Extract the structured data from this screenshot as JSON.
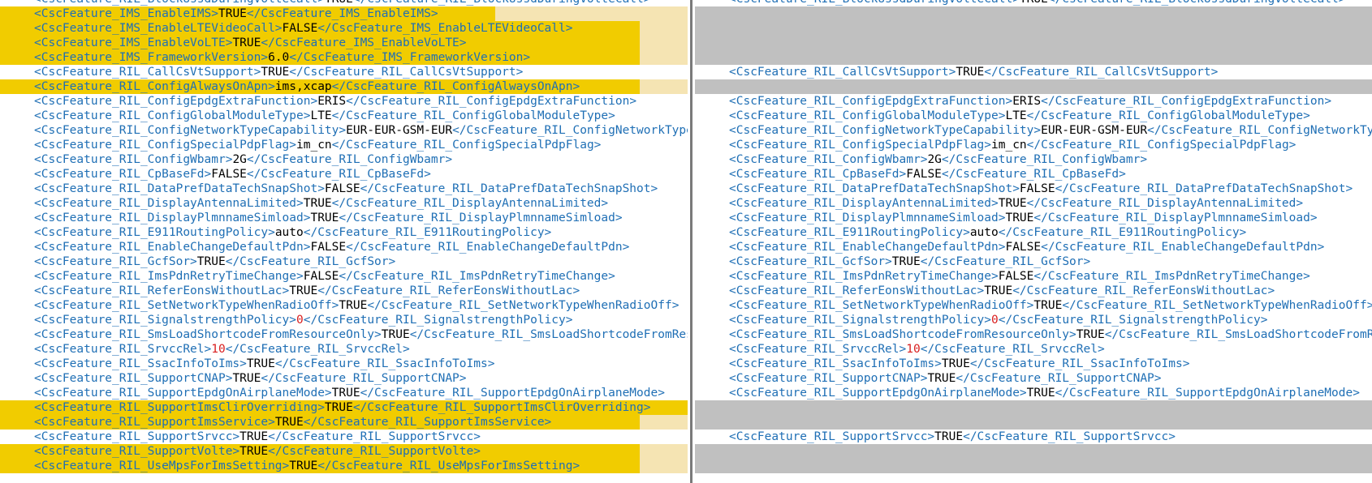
{
  "colors": {
    "tag": "#1f6fb5",
    "value": "#000000",
    "number": "#d92020",
    "changed_bg": "#f5e4b3",
    "changed_highlight": "#f1cc00",
    "gap": "#c0c0c0"
  },
  "left": [
    {
      "open": "<CscFeature_RIL_BlockUssdDuringVolteCall>",
      "value": "TRUE",
      "close": "</CscFeature_RIL_BlockUssdDuringVolteCall>",
      "state": "normal"
    },
    {
      "open": "<CscFeature_IMS_EnableIMS>",
      "value": "TRUE",
      "close": "</CscFeature_IMS_EnableIMS>",
      "state": "changed",
      "hl": 0.72
    },
    {
      "open": "<CscFeature_IMS_EnableLTEVideoCall>",
      "value": "FALSE",
      "close": "</CscFeature_IMS_EnableLTEVideoCall>",
      "state": "changed",
      "hl": 0.93
    },
    {
      "open": "<CscFeature_IMS_EnableVoLTE>",
      "value": "TRUE",
      "close": "</CscFeature_IMS_EnableVoLTE>",
      "state": "changed",
      "hl": 0.93
    },
    {
      "open": "<CscFeature_IMS_FrameworkVersion>",
      "value": "6.0",
      "close": "</CscFeature_IMS_FrameworkVersion>",
      "state": "changed",
      "hl": 0.93
    },
    {
      "open": "<CscFeature_RIL_CallCsVtSupport>",
      "value": "TRUE",
      "close": "</CscFeature_RIL_CallCsVtSupport>",
      "state": "normal"
    },
    {
      "open": "<CscFeature_RIL_ConfigAlwaysOnApn>",
      "value": "ims,xcap",
      "close": "</CscFeature_RIL_ConfigAlwaysOnApn>",
      "state": "changed",
      "hl": 0.93
    },
    {
      "open": "<CscFeature_RIL_ConfigEpdgExtraFunction>",
      "value": "ERIS",
      "close": "</CscFeature_RIL_ConfigEpdgExtraFunction>",
      "state": "normal"
    },
    {
      "open": "<CscFeature_RIL_ConfigGlobalModuleType>",
      "value": "LTE",
      "close": "</CscFeature_RIL_ConfigGlobalModuleType>",
      "state": "normal"
    },
    {
      "open": "<CscFeature_RIL_ConfigNetworkTypeCapability>",
      "value": "EUR-EUR-GSM-EUR",
      "close": "</CscFeature_RIL_ConfigNetworkTypeCapability>",
      "state": "normal"
    },
    {
      "open": "<CscFeature_RIL_ConfigSpecialPdpFlag>",
      "value": "im_cn",
      "close": "</CscFeature_RIL_ConfigSpecialPdpFlag>",
      "state": "normal"
    },
    {
      "open": "<CscFeature_RIL_ConfigWbamr>",
      "value": "2G",
      "close": "</CscFeature_RIL_ConfigWbamr>",
      "state": "normal"
    },
    {
      "open": "<CscFeature_RIL_CpBaseFd>",
      "value": "FALSE",
      "close": "</CscFeature_RIL_CpBaseFd>",
      "state": "normal"
    },
    {
      "open": "<CscFeature_RIL_DataPrefDataTechSnapShot>",
      "value": "FALSE",
      "close": "</CscFeature_RIL_DataPrefDataTechSnapShot>",
      "state": "normal"
    },
    {
      "open": "<CscFeature_RIL_DisplayAntennaLimited>",
      "value": "TRUE",
      "close": "</CscFeature_RIL_DisplayAntennaLimited>",
      "state": "normal"
    },
    {
      "open": "<CscFeature_RIL_DisplayPlmnnameSimload>",
      "value": "TRUE",
      "close": "</CscFeature_RIL_DisplayPlmnnameSimload>",
      "state": "normal"
    },
    {
      "open": "<CscFeature_RIL_E911RoutingPolicy>",
      "value": "auto",
      "close": "</CscFeature_RIL_E911RoutingPolicy>",
      "state": "normal"
    },
    {
      "open": "<CscFeature_RIL_EnableChangeDefaultPdn>",
      "value": "FALSE",
      "close": "</CscFeature_RIL_EnableChangeDefaultPdn>",
      "state": "normal"
    },
    {
      "open": "<CscFeature_RIL_GcfSor>",
      "value": "TRUE",
      "close": "</CscFeature_RIL_GcfSor>",
      "state": "normal"
    },
    {
      "open": "<CscFeature_RIL_ImsPdnRetryTimeChange>",
      "value": "FALSE",
      "close": "</CscFeature_RIL_ImsPdnRetryTimeChange>",
      "state": "normal"
    },
    {
      "open": "<CscFeature_RIL_ReferEonsWithoutLac>",
      "value": "TRUE",
      "close": "</CscFeature_RIL_ReferEonsWithoutLac>",
      "state": "normal"
    },
    {
      "open": "<CscFeature_RIL_SetNetworkTypeWhenRadioOff>",
      "value": "TRUE",
      "close": "</CscFeature_RIL_SetNetworkTypeWhenRadioOff>",
      "state": "normal"
    },
    {
      "open": "<CscFeature_RIL_SignalstrengthPolicy>",
      "value": "0",
      "close": "</CscFeature_RIL_SignalstrengthPolicy>",
      "state": "normal",
      "numeric": true
    },
    {
      "open": "<CscFeature_RIL_SmsLoadShortcodeFromResourceOnly>",
      "value": "TRUE",
      "close": "</CscFeature_RIL_SmsLoadShortcodeFromResourceOnly>",
      "state": "normal"
    },
    {
      "open": "<CscFeature_RIL_SrvccRel>",
      "value": "10",
      "close": "</CscFeature_RIL_SrvccRel>",
      "state": "normal",
      "numeric": true
    },
    {
      "open": "<CscFeature_RIL_SsacInfoToIms>",
      "value": "TRUE",
      "close": "</CscFeature_RIL_SsacInfoToIms>",
      "state": "normal"
    },
    {
      "open": "<CscFeature_RIL_SupportCNAP>",
      "value": "TRUE",
      "close": "</CscFeature_RIL_SupportCNAP>",
      "state": "normal"
    },
    {
      "open": "<CscFeature_RIL_SupportEpdgOnAirplaneMode>",
      "value": "TRUE",
      "close": "</CscFeature_RIL_SupportEpdgOnAirplaneMode>",
      "state": "normal"
    },
    {
      "open": "<CscFeature_RIL_SupportImsClirOverriding>",
      "value": "TRUE",
      "close": "</CscFeature_RIL_SupportImsClirOverriding>",
      "state": "changed",
      "hl": 1.0
    },
    {
      "open": "<CscFeature_RIL_SupportImsService>",
      "value": "TRUE",
      "close": "</CscFeature_RIL_SupportImsService>",
      "state": "changed",
      "hl": 0.93
    },
    {
      "open": "<CscFeature_RIL_SupportSrvcc>",
      "value": "TRUE",
      "close": "</CscFeature_RIL_SupportSrvcc>",
      "state": "normal"
    },
    {
      "open": "<CscFeature_RIL_SupportVolte>",
      "value": "TRUE",
      "close": "</CscFeature_RIL_SupportVolte>",
      "state": "changed",
      "hl": 0.93
    },
    {
      "open": "<CscFeature_RIL_UseMpsForImsSetting>",
      "value": "TRUE",
      "close": "</CscFeature_RIL_UseMpsForImsSetting>",
      "state": "changed",
      "hl": 0.93
    }
  ],
  "right": [
    {
      "open": "<CscFeature_RIL_BlockUssdDuringVolteCall>",
      "value": "TRUE",
      "close": "</CscFeature_RIL_BlockUssdDuringVolteCall>",
      "state": "normal"
    },
    {
      "state": "gap"
    },
    {
      "state": "gap"
    },
    {
      "state": "gap"
    },
    {
      "state": "gap"
    },
    {
      "open": "<CscFeature_RIL_CallCsVtSupport>",
      "value": "TRUE",
      "close": "</CscFeature_RIL_CallCsVtSupport>",
      "state": "normal"
    },
    {
      "state": "gap"
    },
    {
      "open": "<CscFeature_RIL_ConfigEpdgExtraFunction>",
      "value": "ERIS",
      "close": "</CscFeature_RIL_ConfigEpdgExtraFunction>",
      "state": "normal"
    },
    {
      "open": "<CscFeature_RIL_ConfigGlobalModuleType>",
      "value": "LTE",
      "close": "</CscFeature_RIL_ConfigGlobalModuleType>",
      "state": "normal"
    },
    {
      "open": "<CscFeature_RIL_ConfigNetworkTypeCapability>",
      "value": "EUR-EUR-GSM-EUR",
      "close": "</CscFeature_RIL_ConfigNetworkTypeCapability>",
      "state": "normal"
    },
    {
      "open": "<CscFeature_RIL_ConfigSpecialPdpFlag>",
      "value": "im_cn",
      "close": "</CscFeature_RIL_ConfigSpecialPdpFlag>",
      "state": "normal"
    },
    {
      "open": "<CscFeature_RIL_ConfigWbamr>",
      "value": "2G",
      "close": "</CscFeature_RIL_ConfigWbamr>",
      "state": "normal"
    },
    {
      "open": "<CscFeature_RIL_CpBaseFd>",
      "value": "FALSE",
      "close": "</CscFeature_RIL_CpBaseFd>",
      "state": "normal"
    },
    {
      "open": "<CscFeature_RIL_DataPrefDataTechSnapShot>",
      "value": "FALSE",
      "close": "</CscFeature_RIL_DataPrefDataTechSnapShot>",
      "state": "normal"
    },
    {
      "open": "<CscFeature_RIL_DisplayAntennaLimited>",
      "value": "TRUE",
      "close": "</CscFeature_RIL_DisplayAntennaLimited>",
      "state": "normal"
    },
    {
      "open": "<CscFeature_RIL_DisplayPlmnnameSimload>",
      "value": "TRUE",
      "close": "</CscFeature_RIL_DisplayPlmnnameSimload>",
      "state": "normal"
    },
    {
      "open": "<CscFeature_RIL_E911RoutingPolicy>",
      "value": "auto",
      "close": "</CscFeature_RIL_E911RoutingPolicy>",
      "state": "normal"
    },
    {
      "open": "<CscFeature_RIL_EnableChangeDefaultPdn>",
      "value": "FALSE",
      "close": "</CscFeature_RIL_EnableChangeDefaultPdn>",
      "state": "normal"
    },
    {
      "open": "<CscFeature_RIL_GcfSor>",
      "value": "TRUE",
      "close": "</CscFeature_RIL_GcfSor>",
      "state": "normal"
    },
    {
      "open": "<CscFeature_RIL_ImsPdnRetryTimeChange>",
      "value": "FALSE",
      "close": "</CscFeature_RIL_ImsPdnRetryTimeChange>",
      "state": "normal"
    },
    {
      "open": "<CscFeature_RIL_ReferEonsWithoutLac>",
      "value": "TRUE",
      "close": "</CscFeature_RIL_ReferEonsWithoutLac>",
      "state": "normal"
    },
    {
      "open": "<CscFeature_RIL_SetNetworkTypeWhenRadioOff>",
      "value": "TRUE",
      "close": "</CscFeature_RIL_SetNetworkTypeWhenRadioOff>",
      "state": "normal"
    },
    {
      "open": "<CscFeature_RIL_SignalstrengthPolicy>",
      "value": "0",
      "close": "</CscFeature_RIL_SignalstrengthPolicy>",
      "state": "normal",
      "numeric": true
    },
    {
      "open": "<CscFeature_RIL_SmsLoadShortcodeFromResourceOnly>",
      "value": "TRUE",
      "close": "</CscFeature_RIL_SmsLoadShortcodeFromResourceOnly>",
      "state": "normal"
    },
    {
      "open": "<CscFeature_RIL_SrvccRel>",
      "value": "10",
      "close": "</CscFeature_RIL_SrvccRel>",
      "state": "normal",
      "numeric": true
    },
    {
      "open": "<CscFeature_RIL_SsacInfoToIms>",
      "value": "TRUE",
      "close": "</CscFeature_RIL_SsacInfoToIms>",
      "state": "normal"
    },
    {
      "open": "<CscFeature_RIL_SupportCNAP>",
      "value": "TRUE",
      "close": "</CscFeature_RIL_SupportCNAP>",
      "state": "normal"
    },
    {
      "open": "<CscFeature_RIL_SupportEpdgOnAirplaneMode>",
      "value": "TRUE",
      "close": "</CscFeature_RIL_SupportEpdgOnAirplaneMode>",
      "state": "normal"
    },
    {
      "state": "gap"
    },
    {
      "state": "gap"
    },
    {
      "open": "<CscFeature_RIL_SupportSrvcc>",
      "value": "TRUE",
      "close": "</CscFeature_RIL_SupportSrvcc>",
      "state": "normal"
    },
    {
      "state": "gap"
    },
    {
      "state": "gap"
    }
  ]
}
